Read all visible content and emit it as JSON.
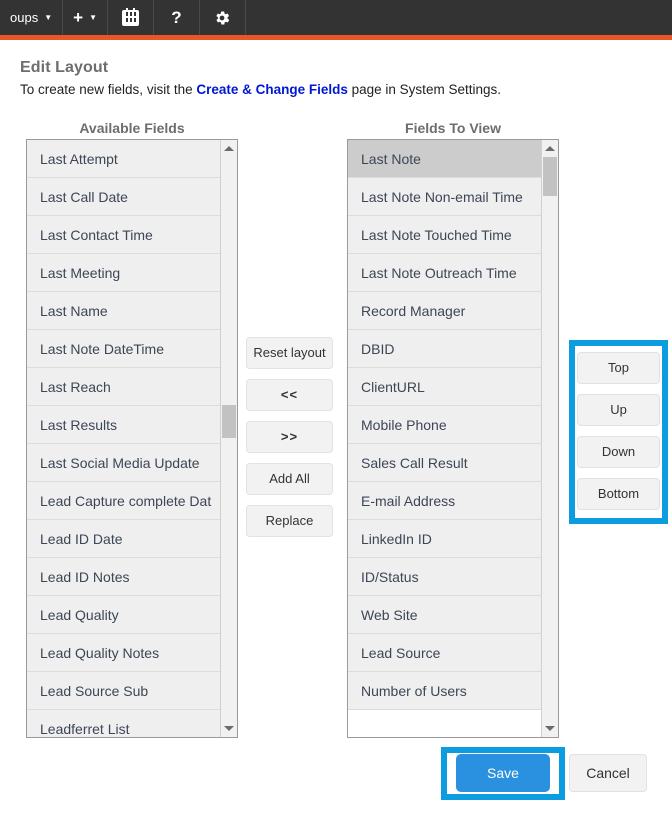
{
  "topnav": {
    "background": "#333333",
    "accent_rule_color": "#e8562a",
    "items": [
      {
        "label": "oups",
        "icon": "chevron-down-icon",
        "has_caret": true
      },
      {
        "label": "+",
        "icon": "plus-icon",
        "has_caret": true
      },
      {
        "label": "",
        "icon": "calendar-icon",
        "has_caret": false
      },
      {
        "label": "?",
        "icon": "help-icon",
        "has_caret": false
      },
      {
        "label": "",
        "icon": "gear-icon",
        "has_caret": false
      }
    ]
  },
  "header": {
    "title": "Edit Layout",
    "subtitle_before": "To create new fields, visit the ",
    "subtitle_link": "Create & Change Fields",
    "subtitle_after": " page in System Settings.",
    "link_color": "#0018d1"
  },
  "available": {
    "heading": "Available Fields",
    "items": [
      "Last Attempt",
      "Last Call Date",
      "Last Contact Time",
      "Last Meeting",
      "Last Name",
      "Last Note DateTime",
      "Last Reach",
      "Last Results",
      "Last Social Media Update",
      "Lead Capture complete Dat",
      "Lead ID Date",
      "Lead ID Notes",
      "Lead Quality",
      "Lead Quality Notes",
      "Lead Source Sub",
      "Leadferret List"
    ],
    "scrollbar": {
      "thumb_top_pct": 44,
      "thumb_height_pct": 6
    }
  },
  "toview": {
    "heading": "Fields To View",
    "selected_index": 0,
    "items": [
      "Last Note",
      "Last Note Non-email Time",
      "Last Note Touched Time",
      "Last Note Outreach Time",
      "Record Manager",
      "DBID",
      "ClientURL",
      "Mobile Phone",
      "Sales Call Result",
      "E-mail Address",
      "LinkedIn ID",
      "ID/Status",
      "Web Site",
      "Lead Source",
      "Number of Users",
      ""
    ],
    "selected_background": "#cccccc",
    "scrollbar": {
      "thumb_top_pct": 0,
      "thumb_height_pct": 7
    }
  },
  "transfer_buttons": [
    "Reset layout",
    "<<",
    ">>",
    "Add All",
    "Replace"
  ],
  "move_buttons": [
    "Top",
    "Up",
    "Down",
    "Bottom"
  ],
  "footer": {
    "save_label": "Save",
    "cancel_label": "Cancel",
    "save_color": "#2a91e0"
  },
  "highlights": {
    "color": "#0b9de0",
    "regions": [
      "move-buttons",
      "save-button"
    ]
  }
}
